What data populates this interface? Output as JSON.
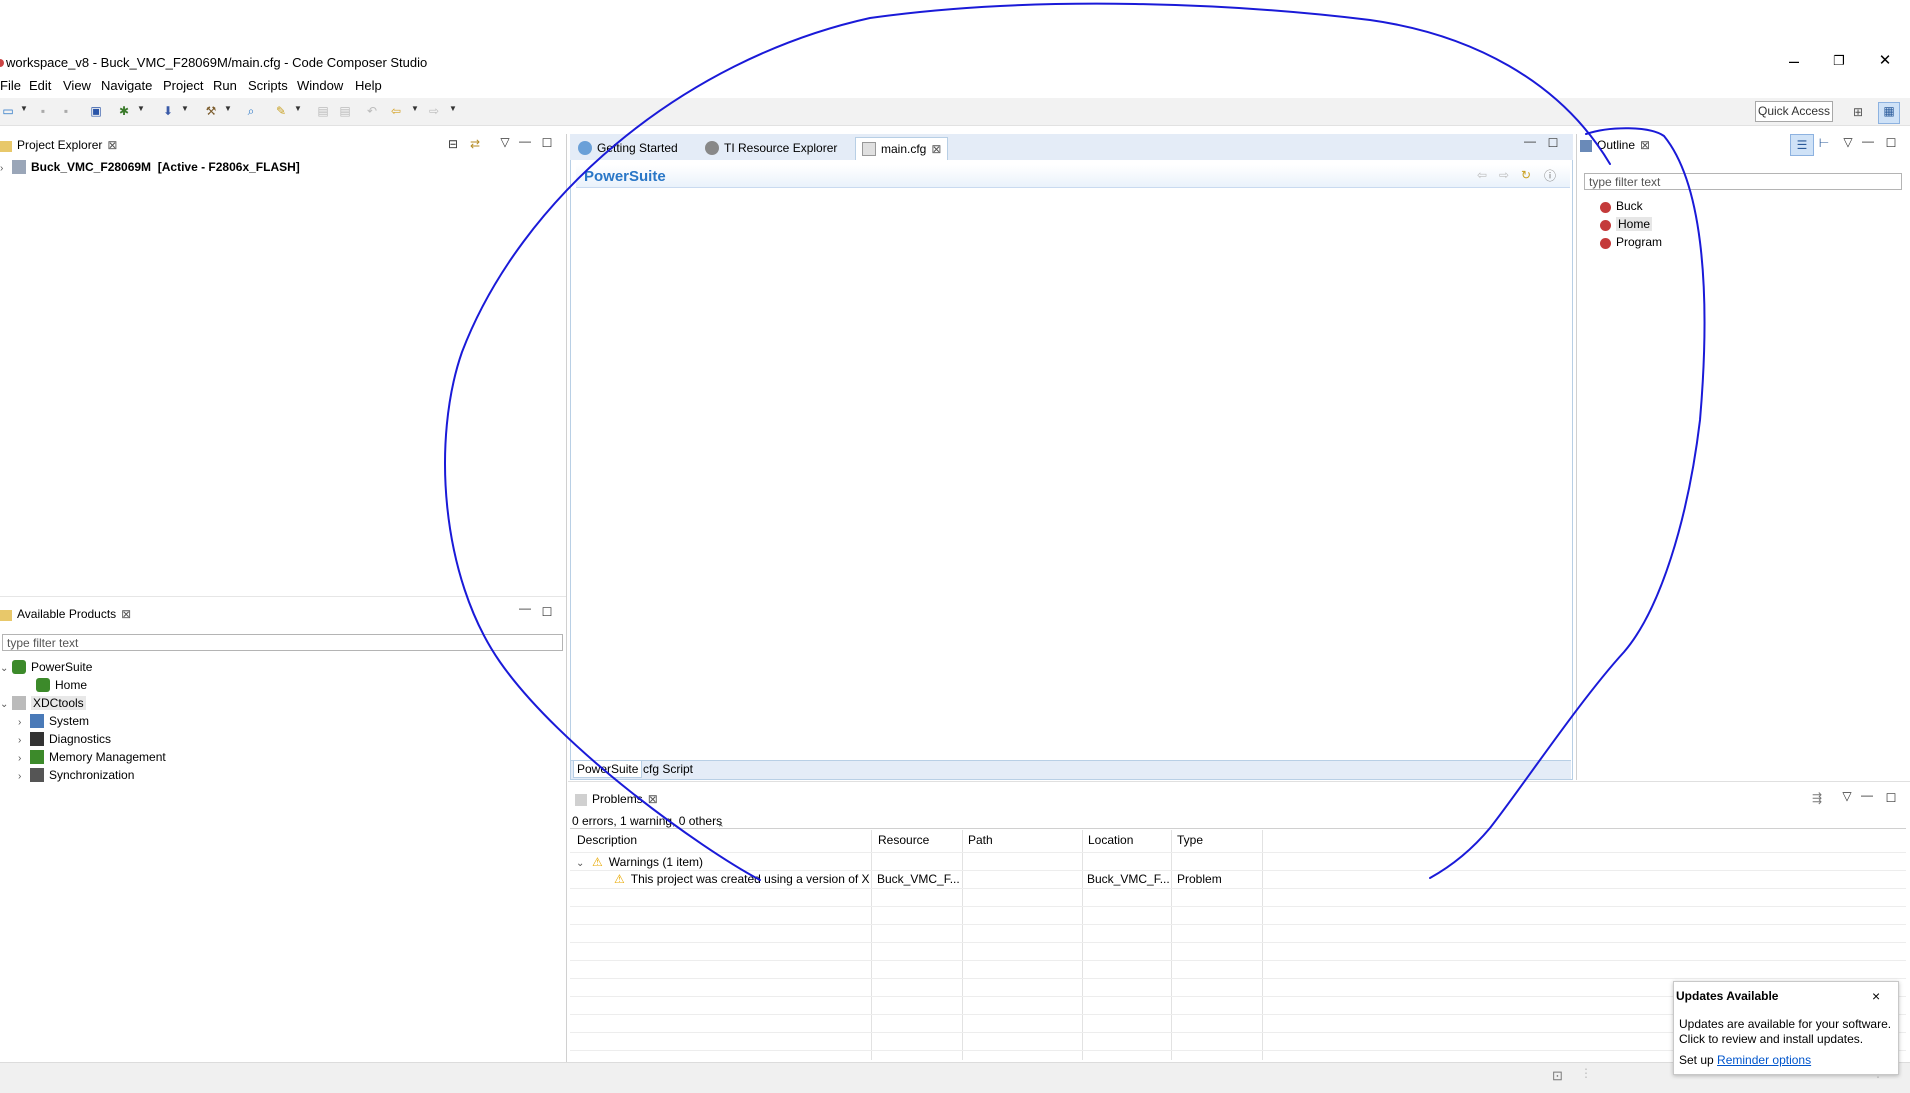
{
  "window": {
    "title": "workspace_v8 - Buck_VMC_F28069M/main.cfg - Code Composer Studio",
    "minimize": "–",
    "restore": "❐",
    "close": "✕"
  },
  "menu": [
    "File",
    "Edit",
    "View",
    "Navigate",
    "Project",
    "Run",
    "Scripts",
    "Window",
    "Help"
  ],
  "toolbar": {
    "quick_access": "Quick Access"
  },
  "project_explorer": {
    "tab": "Project Explorer",
    "project": "Buck_VMC_F28069M",
    "project_status": "[Active - F2806x_FLASH]"
  },
  "available_products": {
    "tab": "Available Products",
    "filter_placeholder": "type filter text",
    "tree": {
      "powersuite": "PowerSuite",
      "home": "Home",
      "xdctools": "XDCtools",
      "system": "System",
      "diagnostics": "Diagnostics",
      "memory": "Memory Management",
      "sync": "Synchronization"
    }
  },
  "editor": {
    "tabs": [
      "Getting Started",
      "TI Resource Explorer",
      "main.cfg"
    ],
    "header": "PowerSuite",
    "bottom_tabs": [
      "PowerSuite",
      "cfg Script"
    ]
  },
  "outline": {
    "tab": "Outline",
    "filter_placeholder": "type filter text",
    "items": [
      "Buck",
      "Home",
      "Program"
    ]
  },
  "problems": {
    "tab": "Problems",
    "summary": "0 errors, 1 warning, 0 others",
    "columns": [
      "Description",
      "Resource",
      "Path",
      "Location",
      "Type"
    ],
    "group": "Warnings (1 item)",
    "row": {
      "description": "This project was created using a version of XD",
      "resource": "Buck_VMC_F...",
      "path": "",
      "location": "Buck_VMC_F...",
      "type": "Problem"
    }
  },
  "popup": {
    "title": "Updates Available",
    "body": "Updates are available for your software. Click to review and install updates.",
    "setup_prefix": "Set up",
    "setup_link": "Reminder options"
  },
  "colors": {
    "accent": "#2a77c7",
    "annotation": "#1a1ad8",
    "warning": "#e8a800"
  }
}
